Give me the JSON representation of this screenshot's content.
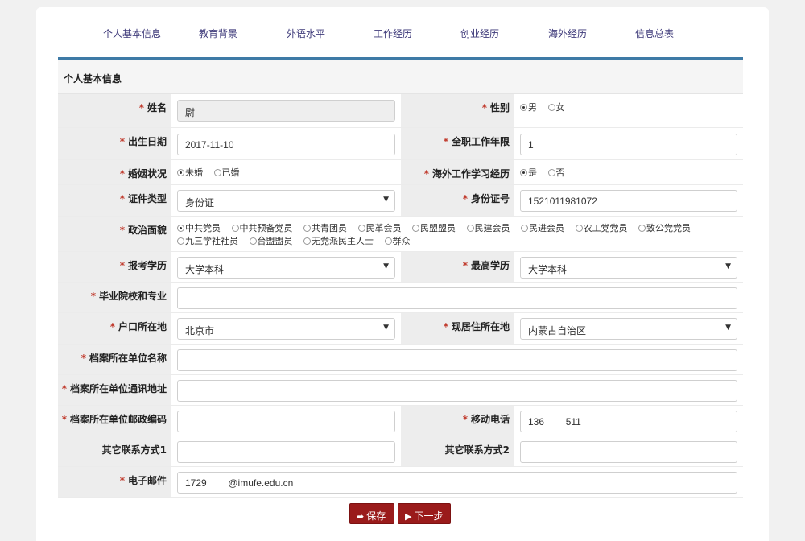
{
  "tabs": [
    "个人基本信息",
    "教育背景",
    "外语水平",
    "工作经历",
    "创业经历",
    "海外经历",
    "信息总表"
  ],
  "section_title": "个人基本信息",
  "required_mark": "*",
  "fields": {
    "name": {
      "label": "姓名",
      "value": "尉"
    },
    "gender": {
      "label": "性别",
      "options": [
        "男",
        "女"
      ],
      "selected": "男"
    },
    "birth": {
      "label": "出生日期",
      "value": "2017-11-10"
    },
    "work_years": {
      "label": "全职工作年限",
      "value": "1"
    },
    "marital": {
      "label": "婚姻状况",
      "options": [
        "未婚",
        "已婚"
      ],
      "selected": "未婚"
    },
    "overseas": {
      "label": "海外工作学习经历",
      "options": [
        "是",
        "否"
      ],
      "selected": "是"
    },
    "id_type": {
      "label": "证件类型",
      "value": "身份证"
    },
    "id_number": {
      "label": "身份证号",
      "value": "1521011981072"
    },
    "political": {
      "label": "政治面貌",
      "options": [
        "中共党员",
        "中共预备党员",
        "共青团员",
        "民革会员",
        "民盟盟员",
        "民建会员",
        "民进会员",
        "农工党党员",
        "致公党党员",
        "九三学社社员",
        "台盟盟员",
        "无党派民主人士",
        "群众"
      ],
      "selected": "中共党员"
    },
    "apply_edu": {
      "label": "报考学历",
      "value": "大学本科"
    },
    "highest_edu": {
      "label": "最高学历",
      "value": "大学本科"
    },
    "school_major": {
      "label": "毕业院校和专业",
      "value": ""
    },
    "hukou": {
      "label": "户口所在地",
      "value": "北京市"
    },
    "residence": {
      "label": "现居住所在地",
      "value": "内蒙古自治区"
    },
    "archive_unit": {
      "label": "档案所在单位名称",
      "value": ""
    },
    "archive_addr": {
      "label": "档案所在单位通讯地址",
      "value": ""
    },
    "archive_zip": {
      "label": "档案所在单位邮政编码",
      "value": ""
    },
    "mobile": {
      "label": "移动电话",
      "value": "136        511"
    },
    "other1": {
      "label": "其它联系方式1",
      "value": ""
    },
    "other2": {
      "label": "其它联系方式2",
      "value": ""
    },
    "email": {
      "label": "电子邮件",
      "value": "1729        @imufe.edu.cn"
    }
  },
  "buttons": {
    "save": "保存",
    "next": "下一步"
  },
  "icons": {
    "save": "share-icon",
    "next": "step-forward-icon"
  },
  "colors": {
    "accent": "#3e7aa6",
    "button": "#9a1b1b",
    "required": "#c0392b",
    "tab_text": "#3e3a7a"
  }
}
